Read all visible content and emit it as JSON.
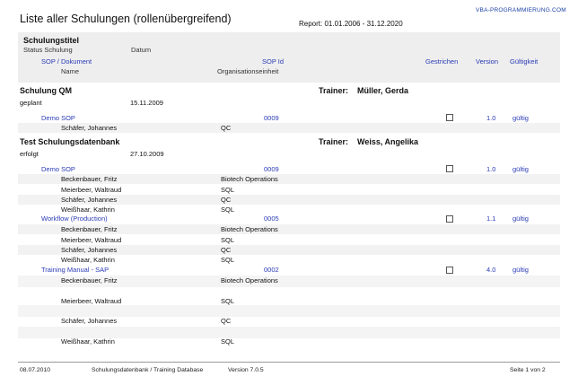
{
  "header": {
    "title": "Liste aller Schulungen (rollenübergreifend)",
    "report": "Report: 01.01.2006 - 31.12.2020",
    "brand": "VBA-PROGRAMMIERUNG.COM"
  },
  "columns": {
    "schulungstitel": "Schulungstitel",
    "status_schulung": "Status Schulung",
    "datum": "Datum",
    "sop_dokument": "SOP / Dokument",
    "sop_id": "SOP Id",
    "name": "Name",
    "organisationseinheit": "Organisationseinheit",
    "gestrichen": "Gestrichen",
    "version": "Version",
    "gueltigkeit": "Gültigkeit"
  },
  "trainer_label": "Trainer:",
  "trainings": [
    {
      "title": "Schulung QM",
      "trainer": "Müller, Gerda",
      "status": "geplant",
      "date": "15.11.2009",
      "docs": [
        {
          "name": "Demo SOP",
          "id": "0009",
          "version": "1.0",
          "validity": "gültig",
          "people": [
            {
              "name": "Schäfer, Johannes",
              "org": "QC"
            }
          ]
        }
      ]
    },
    {
      "title": "Test Schulungsdatenbank",
      "trainer": "Weiss, Angelika",
      "status": "erfolgt",
      "date": "27.10.2009",
      "docs": [
        {
          "name": "Demo SOP",
          "id": "0009",
          "version": "1.0",
          "validity": "gültig",
          "people": [
            {
              "name": "Beckenbauer, Fritz",
              "org": "Biotech Operations"
            },
            {
              "name": "Meierbeer, Waltraud",
              "org": "SQL"
            },
            {
              "name": "Schäfer, Johannes",
              "org": "QC"
            },
            {
              "name": "Weißhaar, Kathrin",
              "org": "SQL"
            }
          ]
        },
        {
          "name": "Workflow (Production)",
          "id": "0005",
          "version": "1.1",
          "validity": "gültig",
          "people": [
            {
              "name": "Beckenbauer, Fritz",
              "org": "Biotech Operations"
            },
            {
              "name": "Meierbeer, Waltraud",
              "org": "SQL"
            },
            {
              "name": "Schäfer, Johannes",
              "org": "QC"
            },
            {
              "name": "Weißhaar, Kathrin",
              "org": "SQL"
            }
          ]
        },
        {
          "name": "Training Manual - SAP",
          "id": "0002",
          "version": "4.0",
          "validity": "gültig",
          "people": [
            {
              "name": "Beckenbauer, Fritz",
              "org": "Biotech Operations"
            },
            {
              "name": "Meierbeer, Waltraud",
              "org": "SQL"
            },
            {
              "name": "Schäfer, Johannes",
              "org": "QC"
            },
            {
              "name": "Weißhaar, Kathrin",
              "org": "SQL"
            }
          ]
        }
      ]
    }
  ],
  "footer": {
    "date": "08.07.2010",
    "app": "Schulungsdatenbank / Training Database",
    "version": "Version 7.0.5",
    "page": "Seite 1 von 2"
  }
}
